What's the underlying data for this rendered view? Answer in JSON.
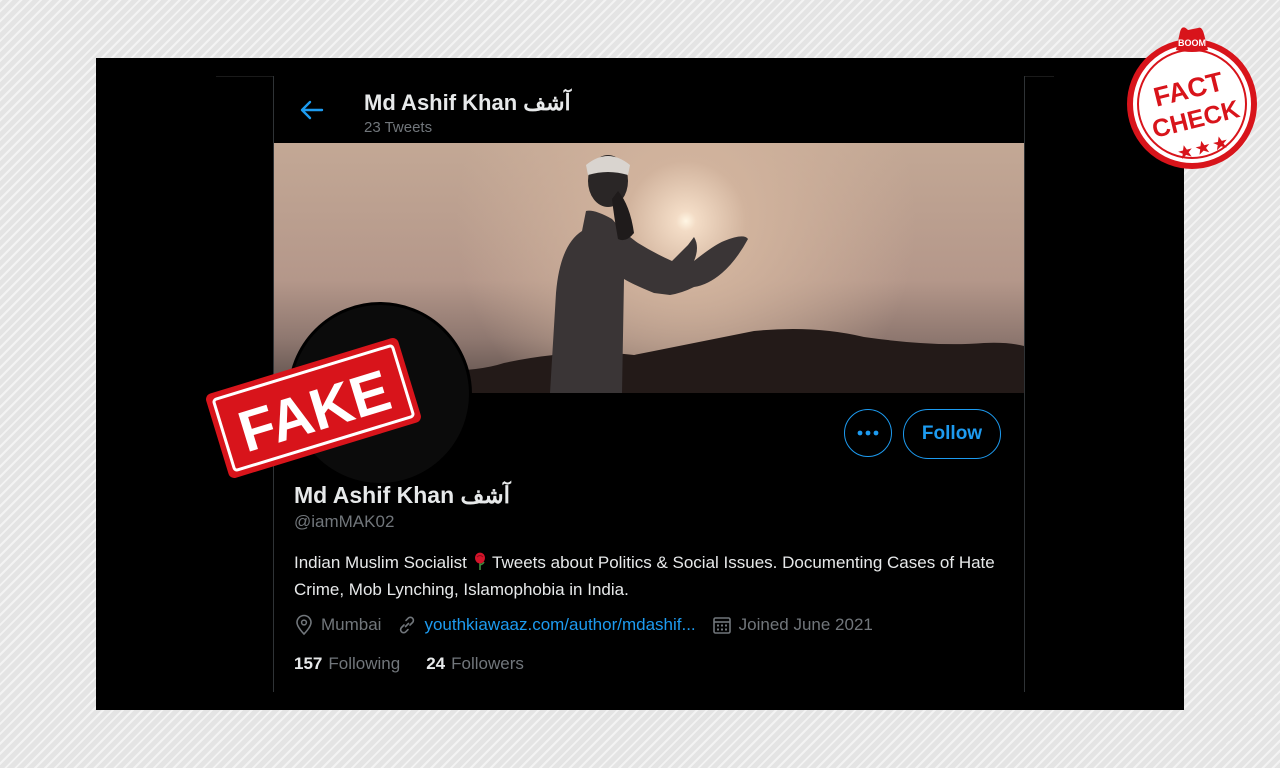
{
  "header": {
    "name": "Md Ashif Khan آشف",
    "tweet_count": "23 Tweets"
  },
  "profile": {
    "display_name": "Md Ashif Khan آشف",
    "handle": "@iamMAK02",
    "bio_part1": "Indian Muslim Socialist ",
    "bio_part2": " Tweets about Politics & Social Issues. Documenting Cases of Hate Crime, Mob Lynching, Islamophobia in India.",
    "location": "Mumbai",
    "website": "youthkiawaaz.com/author/mdashif...",
    "joined": "Joined June 2021",
    "following_count": "157",
    "following_label": "Following",
    "followers_count": "24",
    "followers_label": "Followers"
  },
  "buttons": {
    "more": "•••",
    "follow": "Follow"
  },
  "stamps": {
    "fake": "FAKE",
    "boom": "BOOM",
    "fact": "FACT",
    "check": "CHECK"
  },
  "colors": {
    "accent": "#1d9bf0",
    "stamp_red": "#d8141b",
    "background": "#000000"
  },
  "icons": [
    "back-arrow-icon",
    "rose-icon",
    "location-icon",
    "link-icon",
    "calendar-icon",
    "more-icon"
  ]
}
